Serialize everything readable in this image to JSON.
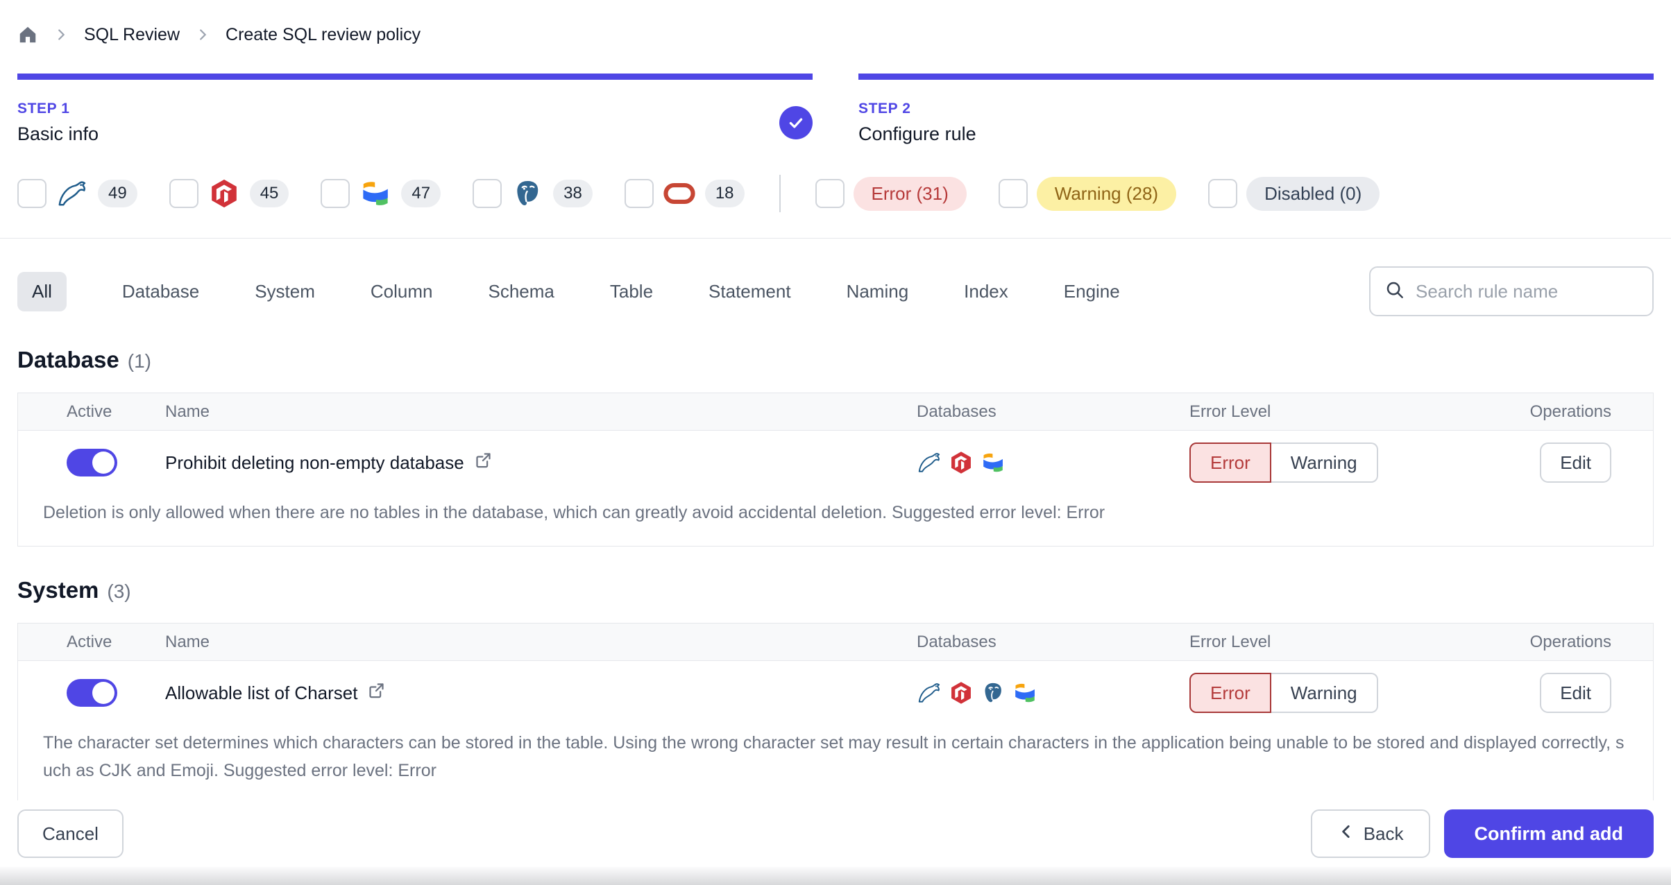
{
  "breadcrumb": {
    "items": [
      "SQL Review",
      "Create SQL review policy"
    ]
  },
  "steps": [
    {
      "label": "STEP 1",
      "title": "Basic info",
      "completed": true
    },
    {
      "label": "STEP 2",
      "title": "Configure rule",
      "completed": false
    }
  ],
  "filters": {
    "engines": [
      {
        "engine": "mysql",
        "count": "49"
      },
      {
        "engine": "tidb",
        "count": "45"
      },
      {
        "engine": "oceanbase",
        "count": "47"
      },
      {
        "engine": "postgresql",
        "count": "38"
      },
      {
        "engine": "oracle",
        "count": "18"
      }
    ],
    "levels": [
      {
        "type": "error",
        "label": "Error (31)"
      },
      {
        "type": "warning",
        "label": "Warning (28)"
      },
      {
        "type": "disabled",
        "label": "Disabled (0)"
      }
    ]
  },
  "tabs": [
    "All",
    "Database",
    "System",
    "Column",
    "Schema",
    "Table",
    "Statement",
    "Naming",
    "Index",
    "Engine"
  ],
  "search": {
    "placeholder": "Search rule name"
  },
  "table_headers": [
    "Active",
    "Name",
    "Databases",
    "Error Level",
    "Operations"
  ],
  "sections": [
    {
      "title": "Database",
      "count": "(1)",
      "rules": [
        {
          "name": "Prohibit deleting non-empty database",
          "active": true,
          "engines": [
            "mysql",
            "tidb",
            "oceanbase"
          ],
          "level": "Error",
          "description": "Deletion is only allowed when there are no tables in the database, which can greatly avoid accidental deletion. Suggested error level: Error"
        }
      ]
    },
    {
      "title": "System",
      "count": "(3)",
      "rules": [
        {
          "name": "Allowable list of Charset",
          "active": true,
          "engines": [
            "mysql",
            "tidb",
            "postgresql",
            "oceanbase"
          ],
          "level": "Error",
          "description": "The character set determines which characters can be stored in the table. Using the wrong character set may result in certain characters in the application being unable to be stored and displayed correctly, such as CJK and Emoji. Suggested error level: Error"
        }
      ]
    }
  ],
  "buttons": {
    "error": "Error",
    "warning": "Warning",
    "edit": "Edit",
    "cancel": "Cancel",
    "back": "Back",
    "confirm": "Confirm and add"
  },
  "colors": {
    "accent": "#4f46e5",
    "error_text": "#b43c3c",
    "error_bg": "#fbe2e2",
    "warning_text": "#8f6417",
    "warning_bg": "#fcf0a4",
    "disabled_bg": "#e9ebef"
  }
}
